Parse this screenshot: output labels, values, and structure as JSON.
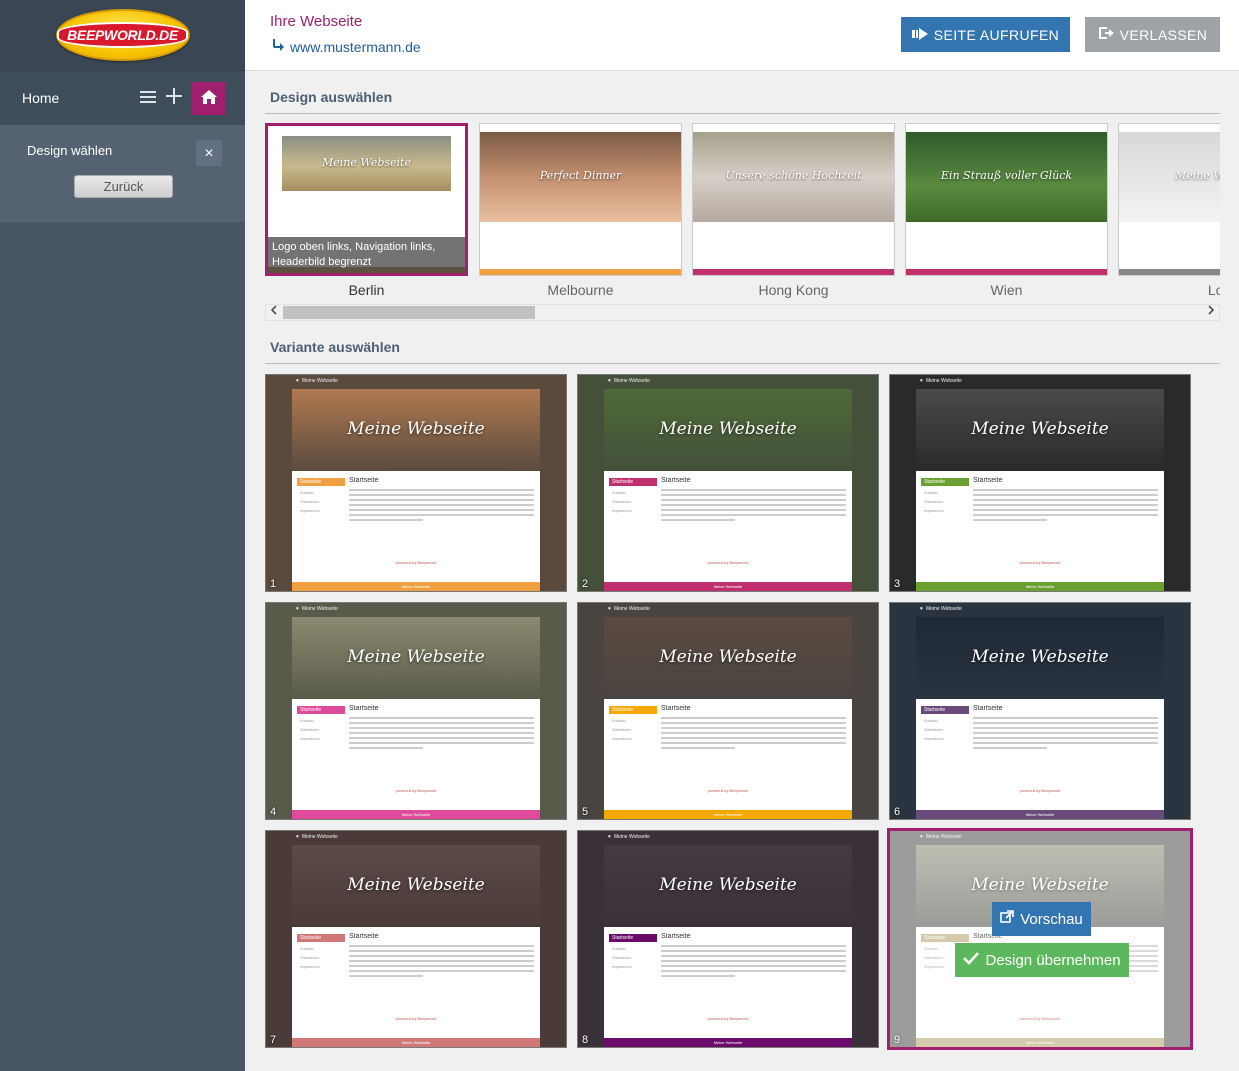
{
  "sidebar": {
    "logo_text": "BEEPWORLD.DE",
    "home_label": "Home",
    "panel_title": "Design wählen",
    "close_label": "×",
    "back_label": "Zurück"
  },
  "header": {
    "site_title": "Ihre Webseite",
    "site_url": "www.mustermann.de",
    "visit_label": "SEITE AUFRUFEN",
    "leave_label": "VERLASSEN"
  },
  "design_section": {
    "title": "Design auswählen",
    "selected_caption": "Logo oben links, Navigation links, Headerbild begrenzt",
    "designs": [
      {
        "name": "Berlin",
        "caption_title": "Meine Webseite",
        "accent": "#c49a6c"
      },
      {
        "name": "Melbourne",
        "caption_title": "Perfect Dinner",
        "accent": "#f0a040"
      },
      {
        "name": "Hong Kong",
        "caption_title": "Unsere schöne Hochzeit",
        "accent": "#c0306f"
      },
      {
        "name": "Wien",
        "caption_title": "Ein Strauß voller Glück",
        "accent": "#c0306f"
      },
      {
        "name": "Lon",
        "caption_title": "Meine Webseite",
        "accent": "#888888"
      }
    ]
  },
  "variant_section": {
    "title": "Variante auswählen",
    "site_name": "Meine Webseite",
    "content_heading": "Startseite",
    "nav_items": [
      "Startseite",
      "Kontakt",
      "Gästebuch",
      "Impressum"
    ],
    "powered": "powered by Beepworld",
    "variants": [
      {
        "number": "1",
        "accent": "#f0a040",
        "bg": "#5a4a3e",
        "header": "#b07a50"
      },
      {
        "number": "2",
        "accent": "#c0306f",
        "bg": "#44503a",
        "header": "#4e6a38"
      },
      {
        "number": "3",
        "accent": "#6aa030",
        "bg": "#2a2a2a",
        "header": "#4a4a4a"
      },
      {
        "number": "4",
        "accent": "#e04a9a",
        "bg": "#5a5a4a",
        "header": "#8a8a70"
      },
      {
        "number": "5",
        "accent": "#f4a800",
        "bg": "#4a4440",
        "header": "#5a4a40"
      },
      {
        "number": "6",
        "accent": "#6a4a7a",
        "bg": "#2a3440",
        "header": "#1e2a36"
      },
      {
        "number": "7",
        "accent": "#d07878",
        "bg": "#4a3a38",
        "header": "#5a4a48"
      },
      {
        "number": "8",
        "accent": "#6a0a6a",
        "bg": "#3a3038",
        "header": "#443a44"
      },
      {
        "number": "9",
        "accent": "#c8b890",
        "bg": "#7a7c78",
        "header": "#a8a898"
      }
    ],
    "preview_label": "Vorschau",
    "apply_label": "Design übernehmen"
  },
  "colors": {
    "brand_magenta": "#a01f6f",
    "primary_blue": "#3375b0",
    "success_green": "#5cb85c"
  }
}
